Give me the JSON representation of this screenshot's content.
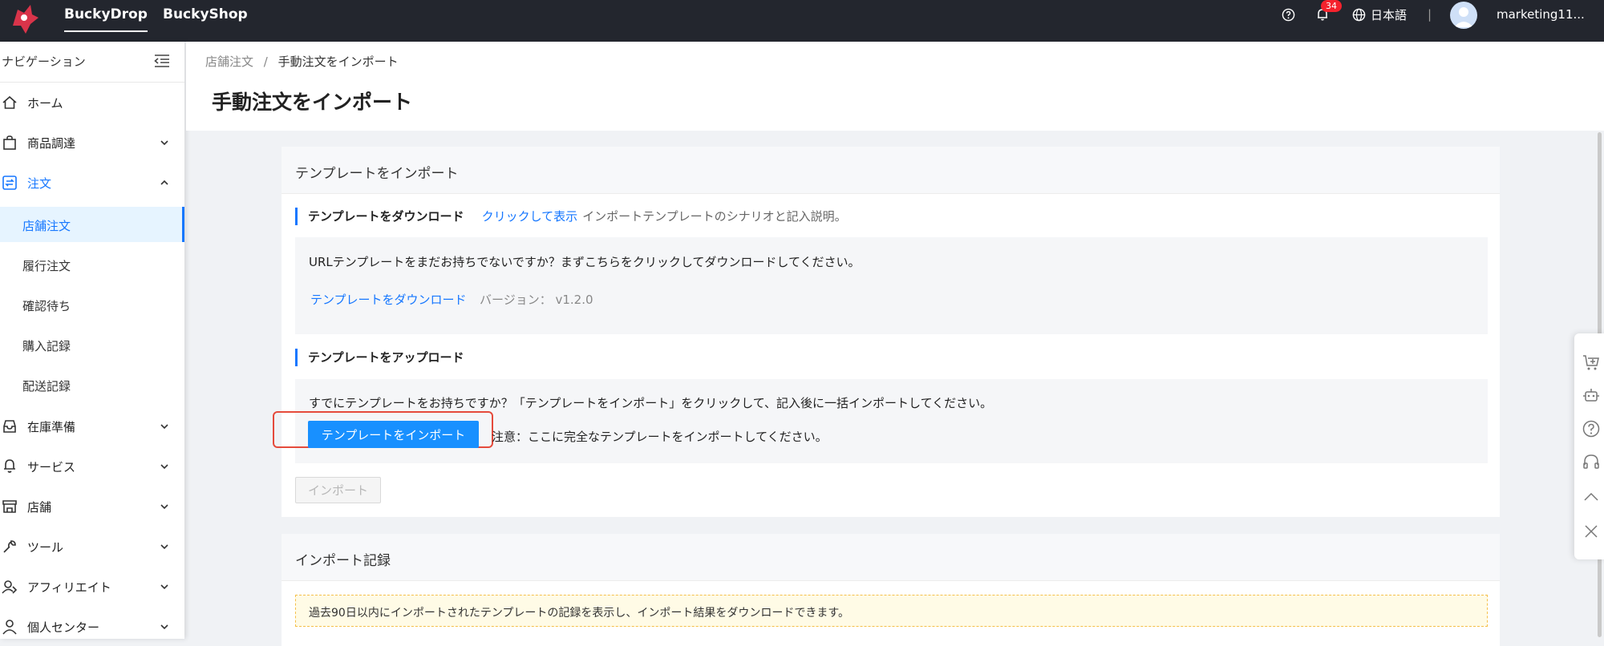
{
  "topbar": {
    "nav": [
      {
        "label": "BuckyDrop"
      },
      {
        "label": "BuckyShop"
      }
    ],
    "notification_count": "34",
    "language": "日本語",
    "separator": "|",
    "user": "marketing11..."
  },
  "sidebar": {
    "header": "ナビゲーション",
    "items": [
      {
        "label": "ホーム",
        "icon": "home-icon"
      },
      {
        "label": "商品調達",
        "icon": "shopping-bag-icon"
      },
      {
        "label": "注文",
        "icon": "order-icon"
      },
      {
        "label": "在庫準備",
        "icon": "inbox-icon"
      },
      {
        "label": "サービス",
        "icon": "service-icon"
      },
      {
        "label": "店舗",
        "icon": "store-icon"
      },
      {
        "label": "ツール",
        "icon": "wrench-icon"
      },
      {
        "label": "アフィリエイト",
        "icon": "affiliate-icon"
      },
      {
        "label": "個人センター",
        "icon": "user-icon"
      }
    ],
    "order_subitems": [
      {
        "label": "店舗注文"
      },
      {
        "label": "履行注文"
      },
      {
        "label": "確認待ち"
      },
      {
        "label": "購入記録"
      },
      {
        "label": "配送記録"
      }
    ]
  },
  "breadcrumb": {
    "parent": "店舗注文",
    "sep": "/",
    "current": "手動注文をインポート"
  },
  "page_title": "手動注文をインポート",
  "import_card": {
    "title": "テンプレートをインポート",
    "download_section": {
      "title": "テンプレートをダウンロード",
      "link": "クリックして表示",
      "desc": "インポートテンプレートのシナリオと記入説明。",
      "prompt": "URLテンプレートをまだお持ちでないですか？まずこちらをクリックしてダウンロードしてください。",
      "download_link": "テンプレートをダウンロード",
      "version": "バージョン： v1.2.0"
    },
    "upload_section": {
      "title": "テンプレートをアップロード",
      "prompt": "すでにテンプレートをお持ちですか？「テンプレートをインポート」をクリックして、記入後に一括インポートしてください。",
      "button": "テンプレートをインポート",
      "note": "注意：ここに完全なテンプレートをインポートしてください。"
    },
    "import_button": "インポート"
  },
  "record_card": {
    "title": "インポート記録",
    "info": "過去90日以内にインポートされたテンプレートの記録を表示し、インポート結果をダウンロードできます。"
  },
  "colors": {
    "accent": "#1677ff",
    "topbar": "#23262e",
    "highlight": "#e54b3c"
  }
}
